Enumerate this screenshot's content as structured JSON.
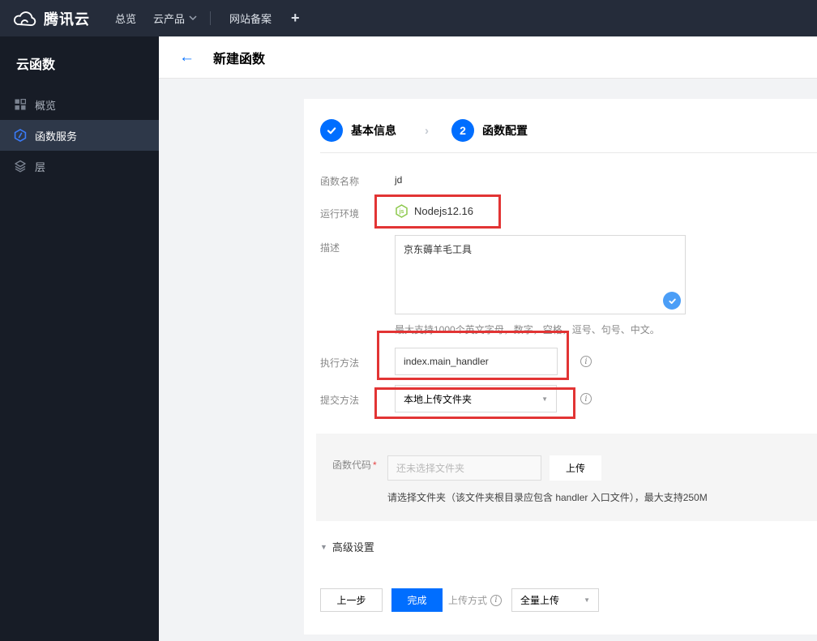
{
  "navbar": {
    "brand": "腾讯云",
    "overview": "总览",
    "products": "云产品",
    "icp": "网站备案",
    "plus": "+"
  },
  "sidebar": {
    "title": "云函数",
    "items": [
      {
        "label": "概览",
        "icon": "grid-icon"
      },
      {
        "label": "函数服务",
        "icon": "function-hexagon-icon"
      },
      {
        "label": "层",
        "icon": "layers-icon"
      }
    ]
  },
  "header": {
    "back": "←",
    "title": "新建函数"
  },
  "steps": {
    "step1": {
      "label": "基本信息",
      "state": "done"
    },
    "step2": {
      "label": "函数配置",
      "number": "2",
      "state": "current"
    }
  },
  "form": {
    "name_label": "函数名称",
    "name_value": "jd",
    "runtime_label": "运行环境",
    "runtime_value": "Nodejs12.16",
    "runtime_icon_text": "js",
    "desc_label": "描述",
    "desc_value": "京东薅羊毛工具",
    "desc_hint": "最大支持1000个英文字母，数字，空格，逗号、句号、中文。",
    "handler_label": "执行方法",
    "handler_value": "index.main_handler",
    "submit_label": "提交方法",
    "submit_value": "本地上传文件夹",
    "code_label": "函数代码",
    "code_required": "*",
    "code_placeholder": "还未选择文件夹",
    "upload_button": "上传",
    "code_hint": "请选择文件夹（该文件夹根目录应包含 handler 入口文件），最大支持250M",
    "advanced_label": "高级设置"
  },
  "footer": {
    "prev_button": "上一步",
    "finish_button": "完成",
    "upload_mode_label": "上传方式",
    "upload_mode_value": "全量上传"
  },
  "colors": {
    "accent_blue": "#006eff",
    "annotation_red": "#e23434",
    "node_green": "#8cc84b",
    "valid_check_blue": "#4b9ef7",
    "topbar_bg": "#252c3a",
    "sidebar_bg": "#171c26"
  }
}
